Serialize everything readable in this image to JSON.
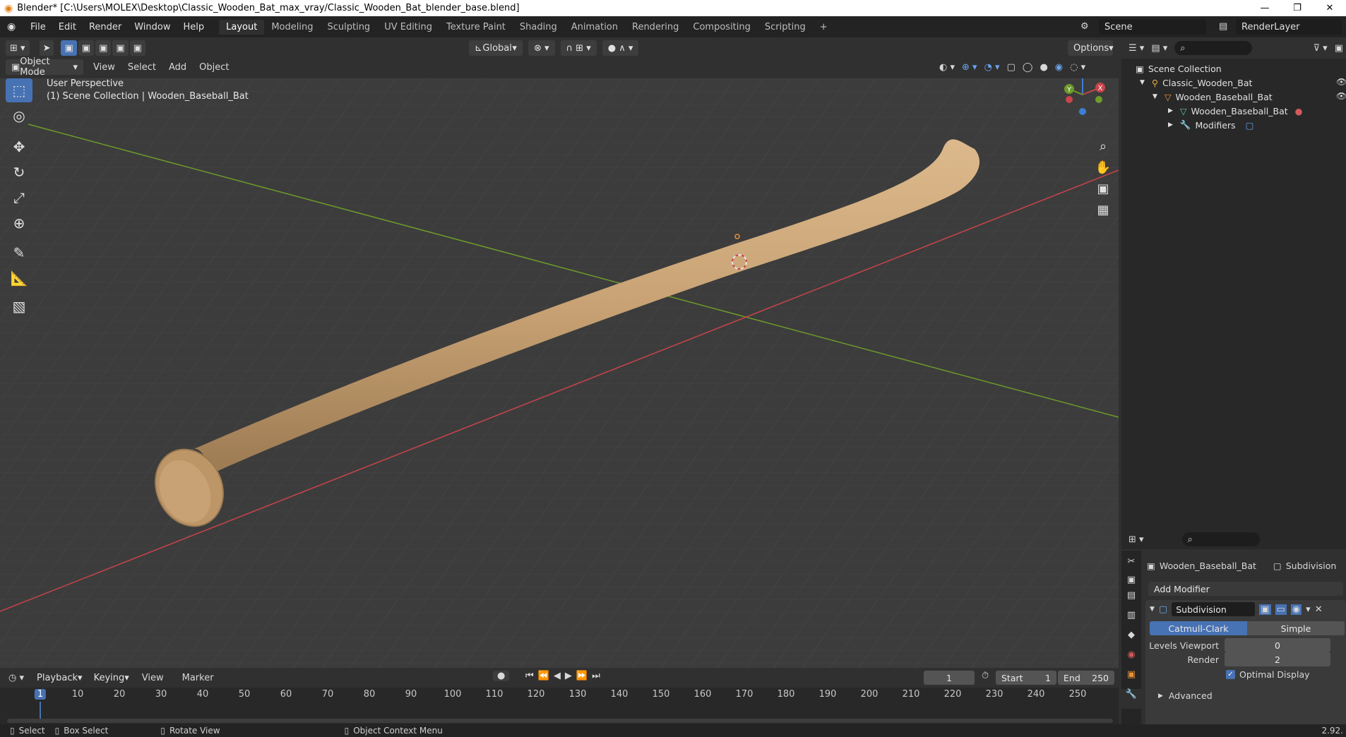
{
  "window": {
    "title": "Blender* [C:\\Users\\MOLEX\\Desktop\\Classic_Wooden_Bat_max_vray/Classic_Wooden_Bat_blender_base.blend]",
    "controls": [
      "—",
      "❐",
      "✕"
    ]
  },
  "menu": [
    "File",
    "Edit",
    "Render",
    "Window",
    "Help"
  ],
  "workspaces": [
    "Layout",
    "Modeling",
    "Sculpting",
    "UV Editing",
    "Texture Paint",
    "Shading",
    "Animation",
    "Rendering",
    "Compositing",
    "Scripting"
  ],
  "active_workspace": "Layout",
  "add_workspace": "+",
  "scene": "Scene",
  "view_layer": "RenderLayer",
  "viewport": {
    "transform_orientation": "Global",
    "options_label": "Options",
    "mode": "Object Mode",
    "header_menus": [
      "View",
      "Select",
      "Add",
      "Object"
    ],
    "perspective_label": "User Perspective",
    "collection_label": "(1) Scene Collection | Wooden_Baseball_Bat",
    "gizmo_axes": {
      "x": "X",
      "y": "Y",
      "z": "Z"
    }
  },
  "colors": {
    "accent": "#4772b3",
    "x_axis": "#c9444b",
    "y_axis": "#6d9b2a",
    "z_axis": "#3d7ed6",
    "grid_bg": "#3c3c3c",
    "wood": "#c8a274"
  },
  "outliner": {
    "search_placeholder": "",
    "root": "Scene Collection",
    "items": [
      {
        "label": "Classic_Wooden_Bat",
        "icon": "armature-icon"
      },
      {
        "label": "Wooden_Baseball_Bat",
        "icon": "object-icon"
      },
      {
        "label": "Wooden_Baseball_Bat",
        "icon": "mesh-icon"
      },
      {
        "label": "Modifiers",
        "icon": "wrench-icon"
      }
    ]
  },
  "properties": {
    "search_placeholder": "",
    "object_name": "Wooden_Baseball_Bat",
    "modifier_tab": "Subdivision",
    "add_modifier_label": "Add Modifier",
    "modifier": {
      "name": "Subdivision",
      "mode_a": "Catmull-Clark",
      "mode_b": "Simple",
      "levels_viewport_label": "Levels Viewport",
      "levels_viewport_value": "0",
      "render_label": "Render",
      "render_value": "2",
      "optimal_display_label": "Optimal Display",
      "optimal_display_checked": true,
      "advanced_label": "Advanced"
    }
  },
  "timeline": {
    "menus": [
      "Playback",
      "Keying",
      "View",
      "Marker"
    ],
    "current_frame": "1",
    "start_label": "Start",
    "start_value": "1",
    "end_label": "End",
    "end_value": "250",
    "ticks": [
      "1",
      "10",
      "20",
      "30",
      "40",
      "50",
      "60",
      "70",
      "80",
      "90",
      "100",
      "110",
      "120",
      "130",
      "140",
      "150",
      "160",
      "170",
      "180",
      "190",
      "200",
      "210",
      "220",
      "230",
      "240",
      "250"
    ]
  },
  "statusbar": {
    "select": "Select",
    "box_select": "Box Select",
    "rotate_view": "Rotate View",
    "context_menu": "Object Context Menu",
    "version": "2.92."
  }
}
